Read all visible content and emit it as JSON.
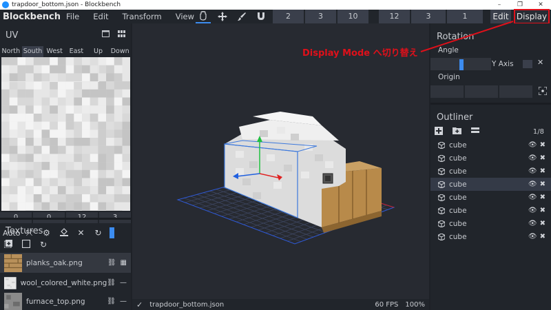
{
  "window": {
    "title": "trapdoor_bottom.json - Blockbench",
    "minimize": "–",
    "maximize": "❐",
    "close": "✕"
  },
  "menubar": {
    "brand": "Blockbench",
    "items": [
      "File",
      "Edit",
      "Transform",
      "View"
    ],
    "tool_icons": [
      "move-hand-icon",
      "move-arrows-icon",
      "brush-icon",
      "magnet-icon"
    ],
    "numbers": [
      "2",
      "3",
      "10",
      "12",
      "3",
      "1"
    ],
    "mode_edit": "Edit",
    "mode_display": "Display"
  },
  "uv_panel": {
    "title": "UV",
    "faces": [
      "North",
      "South",
      "West",
      "East",
      "Up",
      "Down"
    ],
    "selected_face": "South",
    "values": [
      "0",
      "0",
      "12",
      "3"
    ],
    "auto_label": "Auto"
  },
  "textures": {
    "title": "Textures",
    "items": [
      {
        "name": "planks_oak.png",
        "selected": true
      },
      {
        "name": "wool_colored_white.png",
        "selected": false
      },
      {
        "name": "furnace_top.png",
        "selected": false
      }
    ]
  },
  "status": {
    "file": "trapdoor_bottom.json",
    "fps": "60 FPS",
    "zoom": "100%"
  },
  "rotation": {
    "title": "Rotation",
    "angle_label": "Angle",
    "axis_label": "Y Axis",
    "origin_label": "Origin"
  },
  "outliner": {
    "title": "Outliner",
    "count": "1/8",
    "items": [
      "cube",
      "cube",
      "cube",
      "cube",
      "cube",
      "cube",
      "cube",
      "cube"
    ],
    "selected_index": 3
  },
  "annotation": {
    "text": "Display Mode へ切り替え"
  },
  "colors": {
    "accent": "#3c8cf0",
    "annotation_red": "#e0101a",
    "panel": "#21252b",
    "viewport": "#272a31"
  }
}
